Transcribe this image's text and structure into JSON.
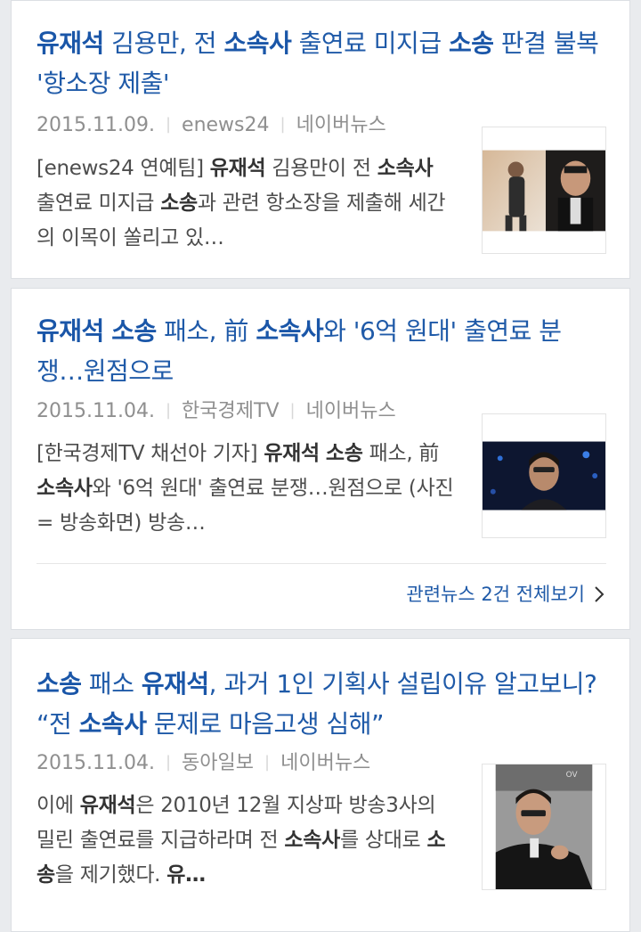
{
  "articles": [
    {
      "title_parts": [
        {
          "t": "유재석",
          "b": true
        },
        {
          "t": " 김용만, 전 ",
          "b": false
        },
        {
          "t": "소속사",
          "b": true
        },
        {
          "t": " 출연료 미지급 ",
          "b": false
        },
        {
          "t": "소송",
          "b": true
        },
        {
          "t": " 판결 불복 '항소장 제출'",
          "b": false
        }
      ],
      "date": "2015.11.09.",
      "press": "enews24",
      "source": "네이버뉴스",
      "summary_parts": [
        {
          "t": "[enews24 연예팀] ",
          "b": false
        },
        {
          "t": "유재석",
          "b": true
        },
        {
          "t": " 김용만이 전 ",
          "b": false
        },
        {
          "t": "소속사",
          "b": true
        },
        {
          "t": " 출연료 미지급 ",
          "b": false
        },
        {
          "t": "소송",
          "b": true
        },
        {
          "t": "과 관련 항소장을 제출해 세간의 이목이 쏠리고 있…",
          "b": false
        }
      ],
      "thumb_icon": "news-photo-two-men"
    },
    {
      "title_parts": [
        {
          "t": "유재석",
          "b": true
        },
        {
          "t": " ",
          "b": false
        },
        {
          "t": "소송",
          "b": true
        },
        {
          "t": " 패소, 前 ",
          "b": false
        },
        {
          "t": "소속사",
          "b": true
        },
        {
          "t": "와 '6억 원대' 출연료 분쟁…원점으로",
          "b": false
        }
      ],
      "date": "2015.11.04.",
      "press": "한국경제TV",
      "source": "네이버뉴스",
      "summary_parts": [
        {
          "t": "[한국경제TV 채선아 기자] ",
          "b": false
        },
        {
          "t": "유재석",
          "b": true
        },
        {
          "t": " ",
          "b": false
        },
        {
          "t": "소송",
          "b": true
        },
        {
          "t": " 패소, 前 ",
          "b": false
        },
        {
          "t": "소속사",
          "b": true
        },
        {
          "t": "와 '6억 원대' 출연료 분쟁…원점으로 (사진 = 방송화면) 방송…",
          "b": false
        }
      ],
      "thumb_icon": "news-photo-tv-screen",
      "related_label": "관련뉴스 2건 전체보기"
    },
    {
      "title_parts": [
        {
          "t": "소송",
          "b": true
        },
        {
          "t": " 패소 ",
          "b": false
        },
        {
          "t": "유재석",
          "b": true
        },
        {
          "t": ", 과거 1인 기획사 설립이유 알고보니? “전 ",
          "b": false
        },
        {
          "t": "소속사",
          "b": true
        },
        {
          "t": " 문제로 마음고생 심해”",
          "b": false
        }
      ],
      "date": "2015.11.04.",
      "press": "동아일보",
      "source": "네이버뉴스",
      "summary_parts": [
        {
          "t": "이에 ",
          "b": false
        },
        {
          "t": "유재석",
          "b": true
        },
        {
          "t": "은 2010년 12월 지상파 방송3사의 밀린 출연료를 지급하라며 전 ",
          "b": false
        },
        {
          "t": "소속사",
          "b": true
        },
        {
          "t": "를 상대로 ",
          "b": false
        },
        {
          "t": "소송",
          "b": true
        },
        {
          "t": "을 제기했다. ",
          "b": false
        },
        {
          "t": "유…",
          "b": true
        }
      ],
      "thumb_icon": "news-photo-man-portrait"
    }
  ]
}
